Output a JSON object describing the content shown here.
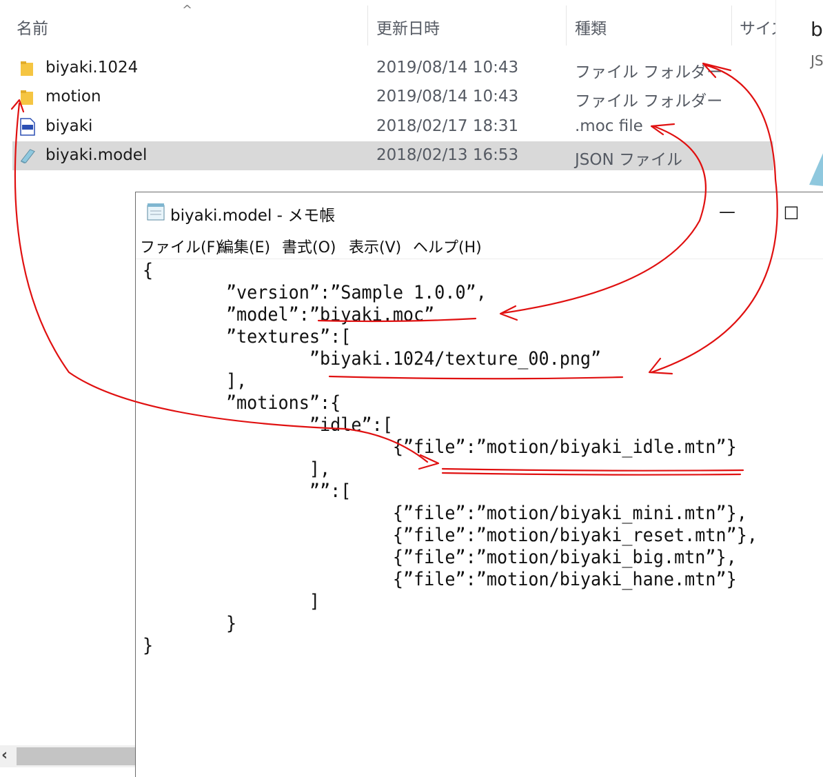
{
  "explorer": {
    "columns": {
      "name": "名前",
      "date": "更新日時",
      "type": "種類",
      "size": "サイズ"
    },
    "sort_indicator": "^",
    "files": [
      {
        "name": "biyaki.1024",
        "date": "2019/08/14 10:43",
        "type": "ファイル フォルダー",
        "icon": "folder-icon"
      },
      {
        "name": "motion",
        "date": "2019/08/14 10:43",
        "type": "ファイル フォルダー",
        "icon": "folder-icon"
      },
      {
        "name": "biyaki",
        "date": "2018/02/17 18:31",
        "type": ".moc file",
        "icon": "moc-file-icon"
      },
      {
        "name": "biyaki.model",
        "date": "2018/02/13 16:53",
        "type": "JSON ファイル",
        "icon": "json-file-icon",
        "selected": true
      }
    ],
    "preview": {
      "title": "b",
      "subtitle": "JS"
    },
    "scroll_arrow": "‹"
  },
  "notepad": {
    "title": "biyaki.model - メモ帳",
    "buttons": {
      "minimize": "—",
      "maximize": "□"
    },
    "menu": [
      "ファイル(F)",
      "編集(E)",
      "書式(O)",
      "表示(V)",
      "ヘルプ(H)"
    ],
    "content": "{\n        ”version”:”Sample 1.0.0”,\n        ”model”:”biyaki.moc”\n        ”textures”:[\n                ”biyaki.1024/texture_00.png”\n        ],\n        ”motions”:{\n                ”idle”:[\n                        {”file”:”motion/biyaki_idle.mtn”}\n                ],\n                ””:[\n                        {”file”:”motion/biyaki_mini.mtn”},\n                        {”file”:”motion/biyaki_reset.mtn”},\n                        {”file”:”motion/biyaki_big.mtn”},\n                        {”file”:”motion/biyaki_hane.mtn”}\n                ]\n        }\n}"
  },
  "colors": {
    "annotation": "#e01010",
    "selection": "#d9d9d9",
    "folder": "#f5c542"
  }
}
